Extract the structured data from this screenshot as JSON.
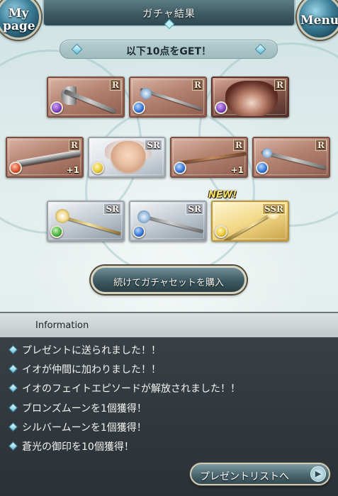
{
  "header": {
    "title": "ガチャ結果",
    "mypage_label": "My page",
    "menu_label": "Menu"
  },
  "banner": {
    "text": "以下10点をGET！"
  },
  "results": {
    "row1": [
      {
        "kind": "weapon",
        "weapon_type": "axe",
        "rarity": "R",
        "element": "dark",
        "element_color": "#7b3fb8"
      },
      {
        "kind": "weapon",
        "weapon_type": "staff",
        "rarity": "R",
        "element": "water",
        "element_color": "#2f6fd6"
      },
      {
        "kind": "summon",
        "rarity": "R",
        "element": "dark",
        "element_color": "#7b3fb8"
      }
    ],
    "row2": [
      {
        "kind": "weapon",
        "weapon_type": "sword",
        "rarity": "R",
        "element": "fire",
        "element_color": "#d84a2a",
        "plus": "+1"
      },
      {
        "kind": "character",
        "rarity": "SR",
        "element": "light",
        "element_color": "#e8c62a"
      },
      {
        "kind": "weapon",
        "weapon_type": "bow",
        "rarity": "R",
        "element": "water",
        "element_color": "#2f6fd6",
        "plus": "+1"
      },
      {
        "kind": "weapon",
        "weapon_type": "staff",
        "rarity": "R",
        "element": "water",
        "element_color": "#2f6fd6"
      }
    ],
    "row3": [
      {
        "kind": "weapon",
        "weapon_type": "staff",
        "rarity": "SR",
        "element": "wind",
        "element_color": "#3fae3a"
      },
      {
        "kind": "weapon",
        "weapon_type": "staff",
        "rarity": "SR",
        "element": "water",
        "element_color": "#2f6fd6"
      },
      {
        "kind": "weapon",
        "weapon_type": "staff",
        "rarity": "SSR",
        "element": "light",
        "element_color": "#e8c62a",
        "new": "NEW!"
      }
    ]
  },
  "buy_button": {
    "label": "続けてガチャセットを購入"
  },
  "information": {
    "title": "Information",
    "items": [
      "プレゼントに送られました！！",
      "イオが仲間に加わりました！！",
      "イオのフェイトエピソードが解放されました！！",
      "ブロンズムーンを1個獲得！",
      "シルバームーンを1個獲得！",
      "蒼光の御印を10個獲得！"
    ]
  },
  "present_button": {
    "label": "プレゼントリストへ",
    "icon": "play-arrow-icon"
  },
  "colors": {
    "accent": "#3d7f98",
    "info_panel": "#2b3136"
  }
}
